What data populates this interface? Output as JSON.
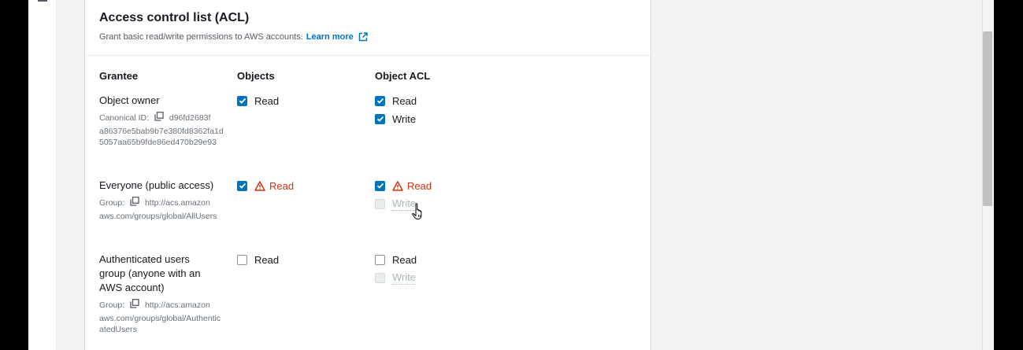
{
  "panel": {
    "title": "Access control list (ACL)",
    "description": "Grant basic read/write permissions to AWS accounts.",
    "learn_more": "Learn more"
  },
  "columns": {
    "grantee": "Grantee",
    "objects": "Objects",
    "object_acl": "Object ACL"
  },
  "rows": [
    {
      "name": "Object owner",
      "meta_label": "Canonical ID:",
      "meta_first": "d96fd2683f",
      "meta_rest": "a86376e5bab9b7e380fd8362fa1d5057aa65b9fde86ed470b29e93",
      "objects_read": {
        "label": "Read",
        "checked": true,
        "warning": false
      },
      "acl_read": {
        "label": "Read",
        "checked": true,
        "warning": false
      },
      "acl_write": {
        "label": "Write",
        "checked": true,
        "disabled": false
      }
    },
    {
      "name": "Everyone (public access)",
      "meta_label": "Group:",
      "meta_first": "http://acs.amazon",
      "meta_rest": "aws.com/groups/global/AllUsers",
      "objects_read": {
        "label": "Read",
        "checked": true,
        "warning": true
      },
      "acl_read": {
        "label": "Read",
        "checked": true,
        "warning": true
      },
      "acl_write": {
        "label": "Write",
        "checked": false,
        "disabled": true
      }
    },
    {
      "name": "Authenticated users group (anyone with an AWS account)",
      "meta_label": "Group:",
      "meta_first": "http://acs.amazon",
      "meta_rest": "aws.com/groups/global/AuthenticatedUsers",
      "objects_read": {
        "label": "Read",
        "checked": false,
        "warning": false
      },
      "acl_read": {
        "label": "Read",
        "checked": false,
        "warning": false
      },
      "acl_write": {
        "label": "Write",
        "checked": false,
        "disabled": true
      }
    }
  ],
  "icons": {
    "copy": "copy-icon",
    "external": "external-link-icon",
    "warning": "warning-icon",
    "check": "checkmark-icon",
    "cursor": "hand-pointer-icon"
  },
  "colors": {
    "accent": "#0073bb",
    "warning": "#d13212",
    "disabled": "#aab7b8"
  }
}
